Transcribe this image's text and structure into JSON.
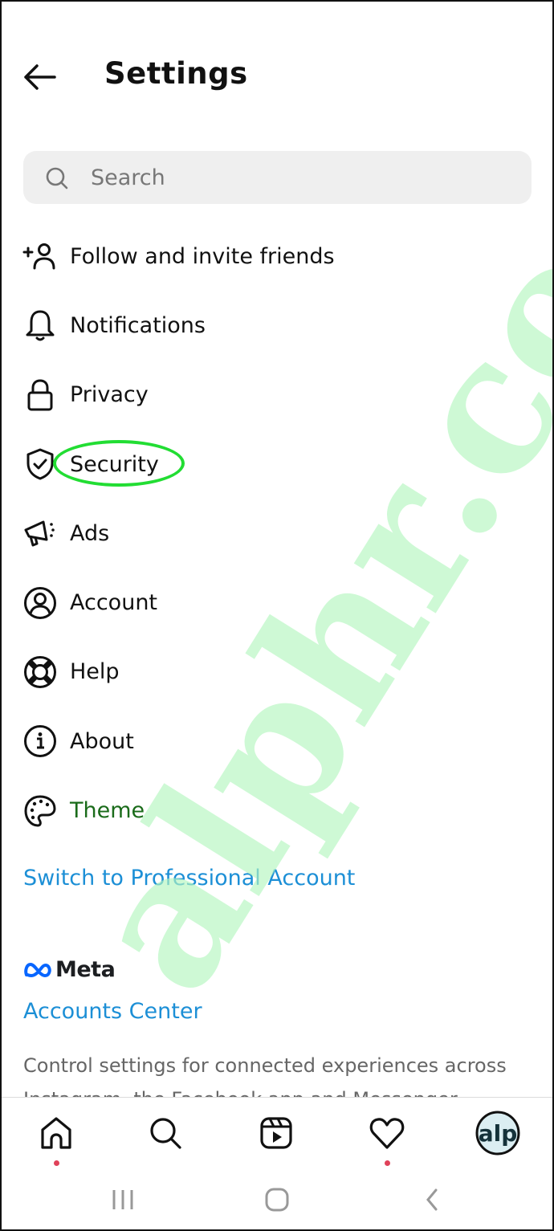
{
  "header": {
    "title": "Settings",
    "back_icon": "arrow-left-icon"
  },
  "search": {
    "placeholder": "Search",
    "value": "",
    "icon": "search-icon"
  },
  "menu": {
    "items": [
      {
        "label": "Follow and invite friends",
        "icon": "add-person-icon"
      },
      {
        "label": "Notifications",
        "icon": "bell-icon"
      },
      {
        "label": "Privacy",
        "icon": "lock-icon"
      },
      {
        "label": "Security",
        "icon": "shield-check-icon",
        "highlighted": true
      },
      {
        "label": "Ads",
        "icon": "megaphone-icon"
      },
      {
        "label": "Account",
        "icon": "account-circle-icon"
      },
      {
        "label": "Help",
        "icon": "lifebuoy-icon"
      },
      {
        "label": "About",
        "icon": "info-icon"
      },
      {
        "label": "Theme",
        "icon": "palette-icon"
      }
    ]
  },
  "links": {
    "switch_professional": "Switch to Professional Account",
    "meta_brand": "Meta",
    "accounts_center": "Accounts Center",
    "accounts_center_desc": "Control settings for connected experiences across Instagram, the Facebook app and Messenger."
  },
  "bottom_nav": {
    "items": [
      {
        "name": "home",
        "icon": "home-icon",
        "notification_dot": true
      },
      {
        "name": "search",
        "icon": "search-icon",
        "notification_dot": false
      },
      {
        "name": "reels",
        "icon": "reels-icon",
        "notification_dot": false
      },
      {
        "name": "activity",
        "icon": "heart-icon",
        "notification_dot": true
      },
      {
        "name": "profile",
        "icon": "avatar",
        "avatar_text": "alp",
        "notification_dot": false
      }
    ]
  },
  "system_nav": {
    "items": [
      "recent-apps",
      "home",
      "back"
    ]
  },
  "watermark": {
    "text": "alphr.com"
  },
  "colors": {
    "link": "#1c8fd6",
    "highlight": "#22dd33",
    "notification_dot": "#e0425a",
    "search_bg": "#efefef",
    "watermark": "#b4f7c0"
  }
}
